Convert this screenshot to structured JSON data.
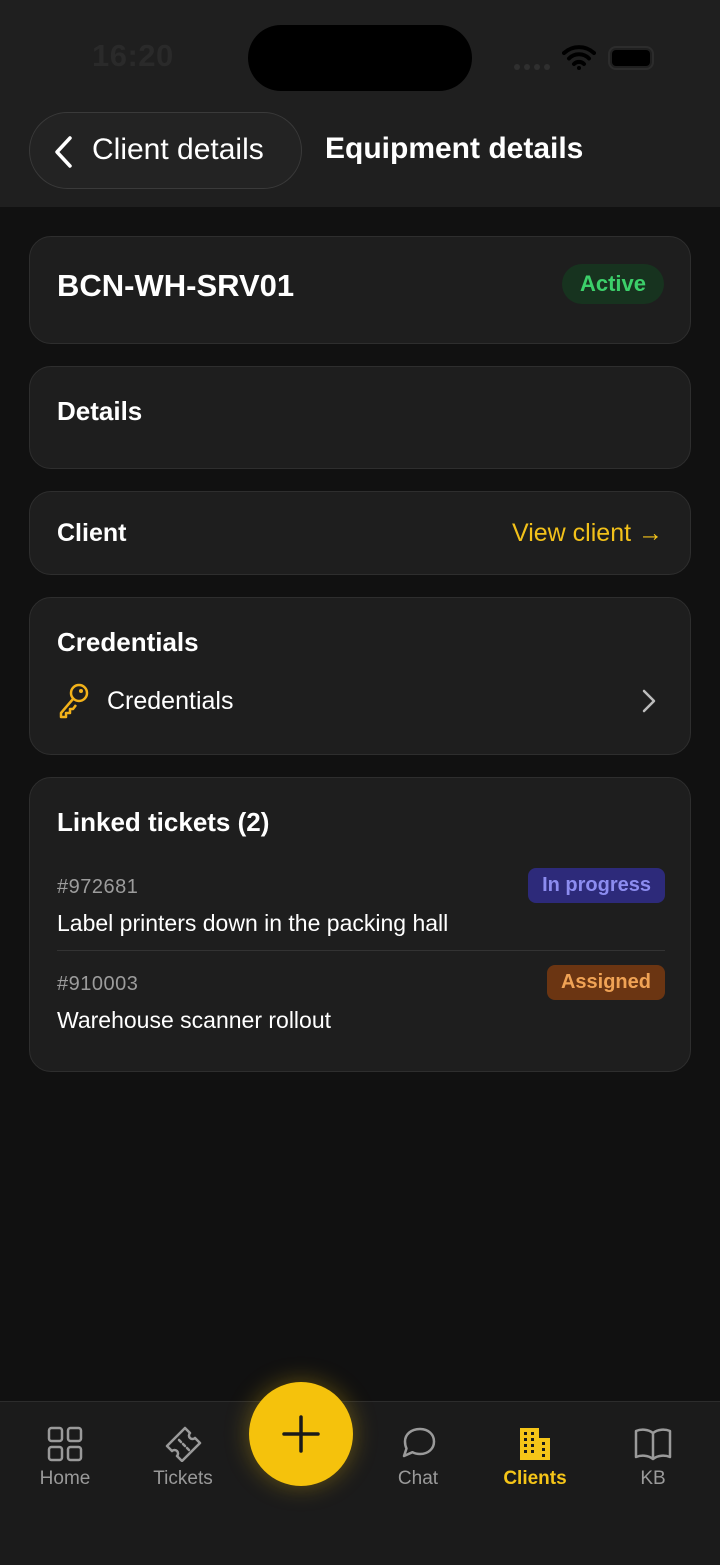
{
  "status_bar": {
    "time": "16:20"
  },
  "header": {
    "back_label": "Client details",
    "title": "Equipment details"
  },
  "equipment": {
    "name": "BCN-WH-SRV01",
    "status": "Active",
    "status_color": "#3ccf6a"
  },
  "details_section": {
    "title": "Details"
  },
  "client_section": {
    "label": "Client",
    "link_label": "View client →",
    "link_color": "#f2c11a"
  },
  "credentials_section": {
    "title": "Credentials",
    "item_label": "Credentials",
    "item_icon": "key-icon"
  },
  "linked_tickets": {
    "title": "Linked tickets (2)",
    "items": [
      {
        "id": "#972681",
        "title": "Label printers down in the packing hall",
        "status": "In progress",
        "status_color": "#8c8cf0"
      },
      {
        "id": "#910003",
        "title": "Warehouse scanner rollout",
        "status": "Assigned",
        "status_color": "#f0a355"
      }
    ]
  },
  "bottom_nav": {
    "items": [
      {
        "label": "Home",
        "icon": "grid-icon"
      },
      {
        "label": "Tickets",
        "icon": "ticket-icon"
      },
      {
        "label": "Chat",
        "icon": "chat-bubble-icon"
      },
      {
        "label": "Clients",
        "icon": "building-icon",
        "active": true
      },
      {
        "label": "KB",
        "icon": "book-icon"
      }
    ],
    "fab_icon": "plus-icon",
    "accent_color": "#f5c518"
  }
}
